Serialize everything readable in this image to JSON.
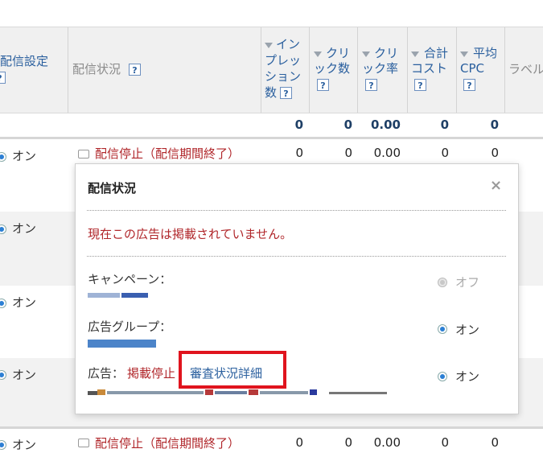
{
  "header": {
    "delivery_setting": "配信設定",
    "delivery_status": "配信状況",
    "impressions": [
      "イン",
      "プレッ",
      "ション",
      "数"
    ],
    "clicks": [
      "クリ",
      "ック数"
    ],
    "ctr": [
      "クリ",
      "ック率"
    ],
    "total_cost": [
      "合計",
      "コスト"
    ],
    "avg_cpc": [
      "平均",
      "CPC"
    ],
    "label": "ラベル",
    "help_glyph": "?"
  },
  "totals": {
    "impressions": "0",
    "clicks": "0",
    "ctr": "0.00",
    "cost": "0",
    "cpc": "0"
  },
  "rows": [
    {
      "setting": "オン",
      "status": "配信停止（配信期間終了）",
      "impressions": "0",
      "clicks": "0",
      "ctr": "0.00",
      "cost": "0",
      "cpc": "0"
    },
    {
      "setting": "オン"
    },
    {
      "setting": "オン"
    },
    {
      "setting": "オン"
    },
    {
      "setting": "オン",
      "status": "配信停止（配信期間終了）",
      "impressions": "0",
      "clicks": "0",
      "ctr": "0.00",
      "cost": "0",
      "cpc": "0"
    }
  ],
  "popup": {
    "title": "配信状況",
    "close": "×",
    "message": "現在この広告は掲載されていません。",
    "campaign_label": "キャンペーン：",
    "campaign_state": "オフ",
    "adgroup_label": "広告グループ：",
    "adgroup_state": "オン",
    "ad_label": "広告：",
    "ad_status": "掲載停止",
    "review_link": "審査状況詳細",
    "ad_state": "オン"
  },
  "colors": {
    "link": "#2a5f9e",
    "status_red": "#b0262a",
    "highlight": "#e0141e"
  }
}
